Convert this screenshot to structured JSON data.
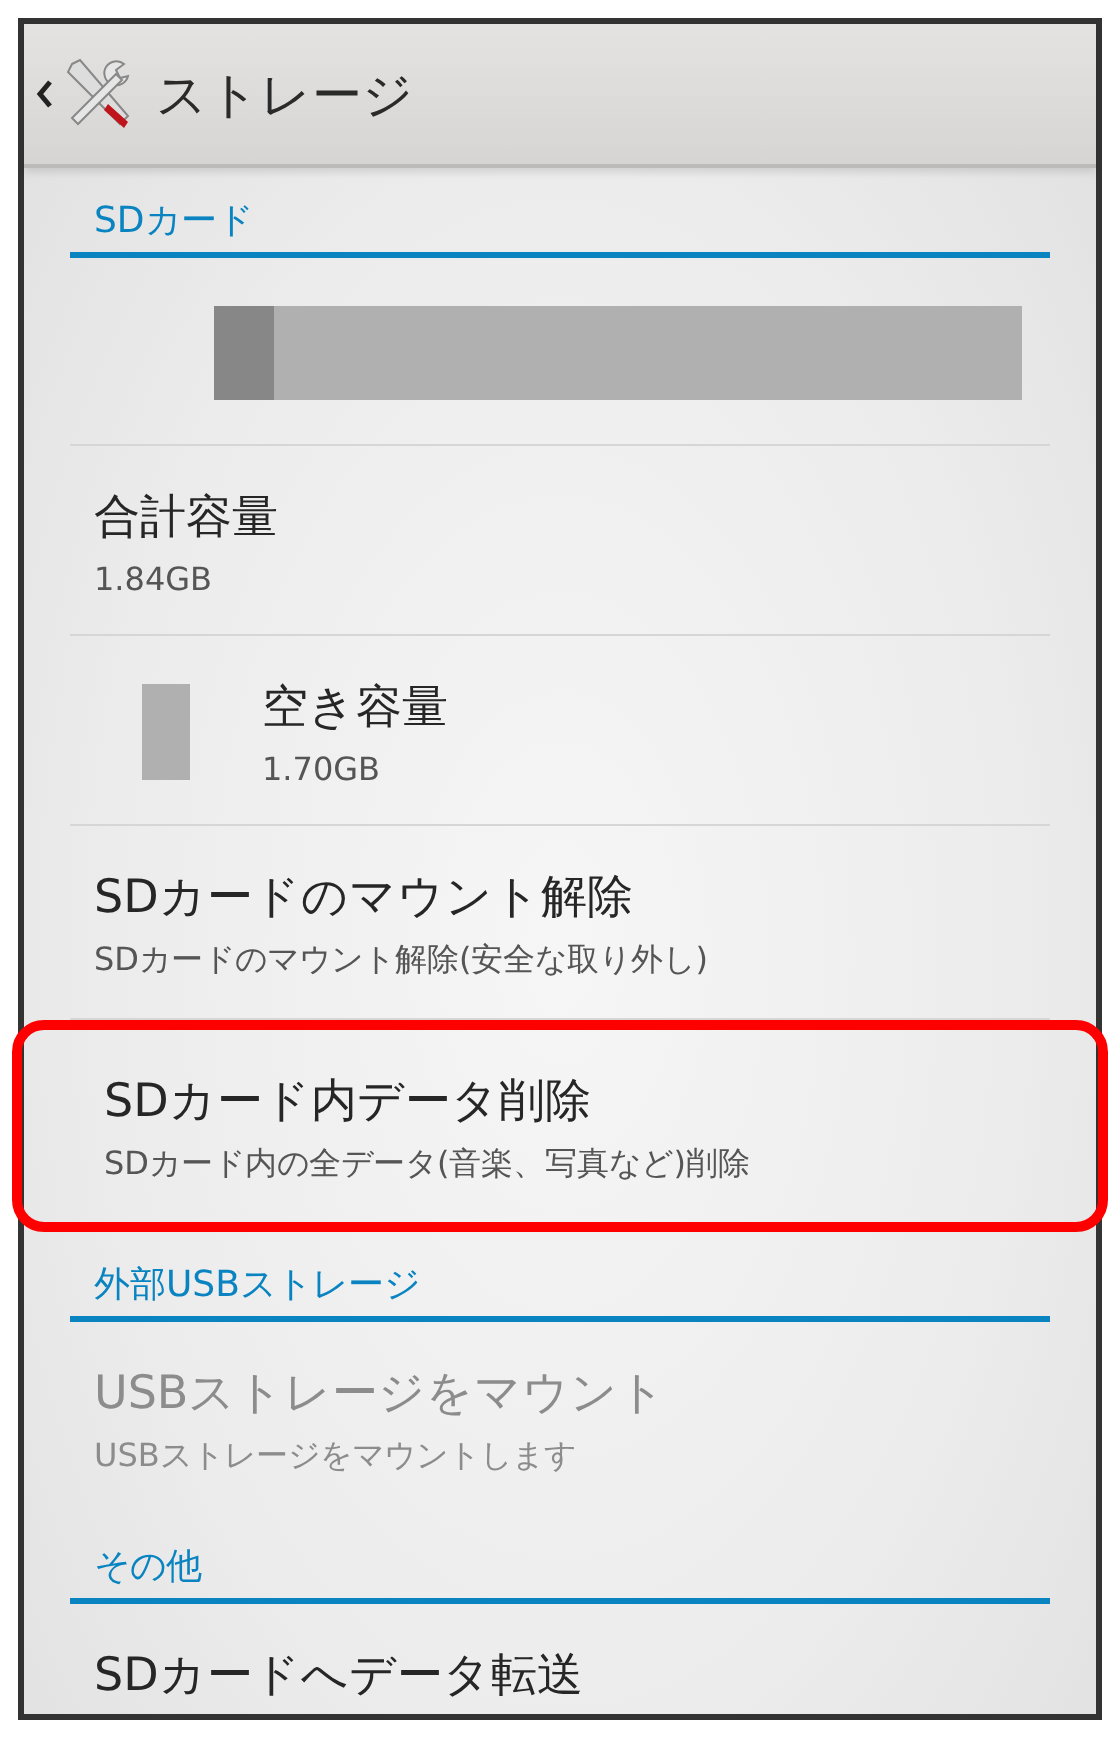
{
  "header": {
    "title": "ストレージ"
  },
  "sections": [
    {
      "title": "SDカード",
      "items": [
        {
          "kind": "bar",
          "level": 0.075
        },
        {
          "kind": "text",
          "title": "合計容量",
          "summary": "1.84GB",
          "disabled": false,
          "highlighted": false
        },
        {
          "kind": "legend",
          "title": "空き容量",
          "summary": "1.70GB",
          "disabled": false,
          "highlighted": false
        },
        {
          "kind": "text",
          "title": "SDカードのマウント解除",
          "summary": "SDカードのマウント解除(安全な取り外し)",
          "disabled": false,
          "highlighted": false
        },
        {
          "kind": "text",
          "title": "SDカード内データ削除",
          "summary": "SDカード内の全データ(音楽、写真など)削除",
          "disabled": false,
          "highlighted": true
        }
      ]
    },
    {
      "title": "外部USBストレージ",
      "items": [
        {
          "kind": "text",
          "title": "USBストレージをマウント",
          "summary": "USBストレージをマウントします",
          "disabled": true,
          "highlighted": false
        }
      ]
    },
    {
      "title": "その他",
      "items": [
        {
          "kind": "text",
          "title": "SDカードへデータ転送",
          "disabled": false,
          "highlighted": false
        }
      ]
    }
  ]
}
